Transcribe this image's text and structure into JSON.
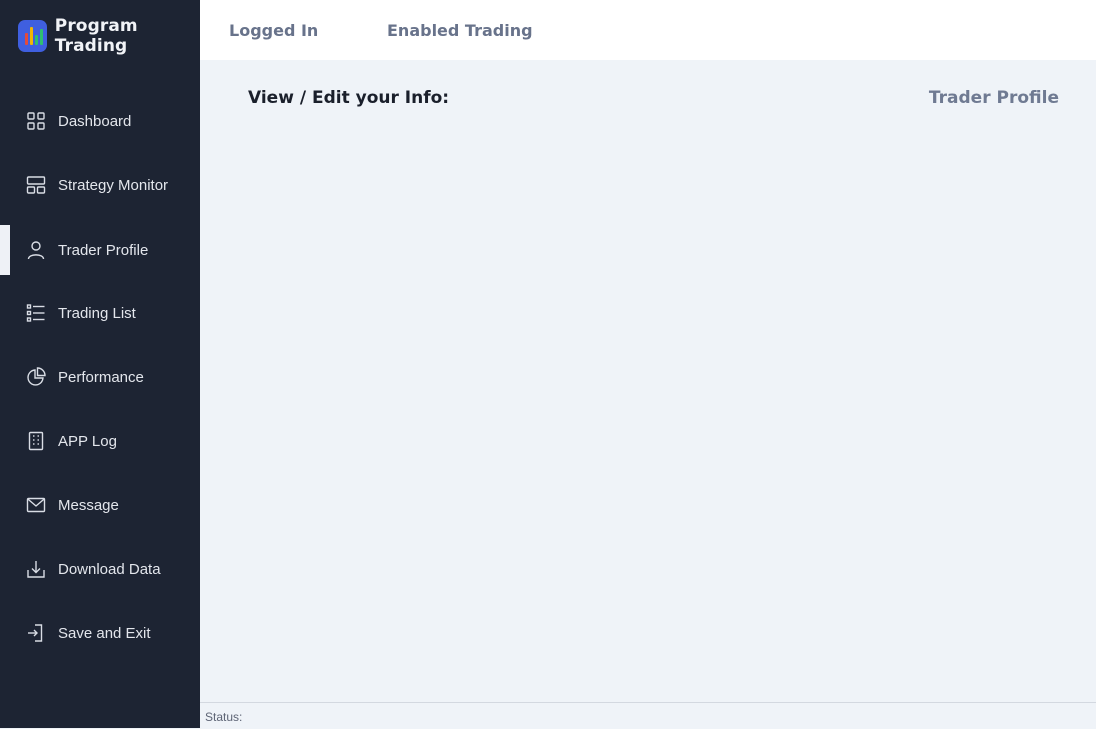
{
  "app": {
    "title": "Program Trading"
  },
  "sidebar": {
    "items": [
      {
        "label": "Dashboard",
        "icon": "grid-icon"
      },
      {
        "label": "Strategy Monitor",
        "icon": "layout-icon"
      },
      {
        "label": "Trader Profile",
        "icon": "user-icon",
        "active": true
      },
      {
        "label": "Trading List",
        "icon": "list-icon"
      },
      {
        "label": "Performance",
        "icon": "pie-chart-icon"
      },
      {
        "label": "APP Log",
        "icon": "log-icon"
      },
      {
        "label": "Message",
        "icon": "mail-icon"
      },
      {
        "label": "Download Data",
        "icon": "download-icon"
      },
      {
        "label": "Save and Exit",
        "icon": "exit-icon"
      }
    ]
  },
  "header": {
    "logged_in": "Logged In",
    "enabled_trading": "Enabled Trading"
  },
  "main": {
    "section_title": "View / Edit your Info:",
    "page_title": "Trader Profile"
  },
  "status": {
    "label": "Status:"
  },
  "colors": {
    "sidebar_bg": "#1d2433",
    "content_bg": "#eff3f8",
    "logo_bg": "#3f5fe0",
    "logo_bar_red": "#e24b3b",
    "logo_bar_yellow": "#f2b705",
    "logo_bar_green": "#2fbf71"
  }
}
